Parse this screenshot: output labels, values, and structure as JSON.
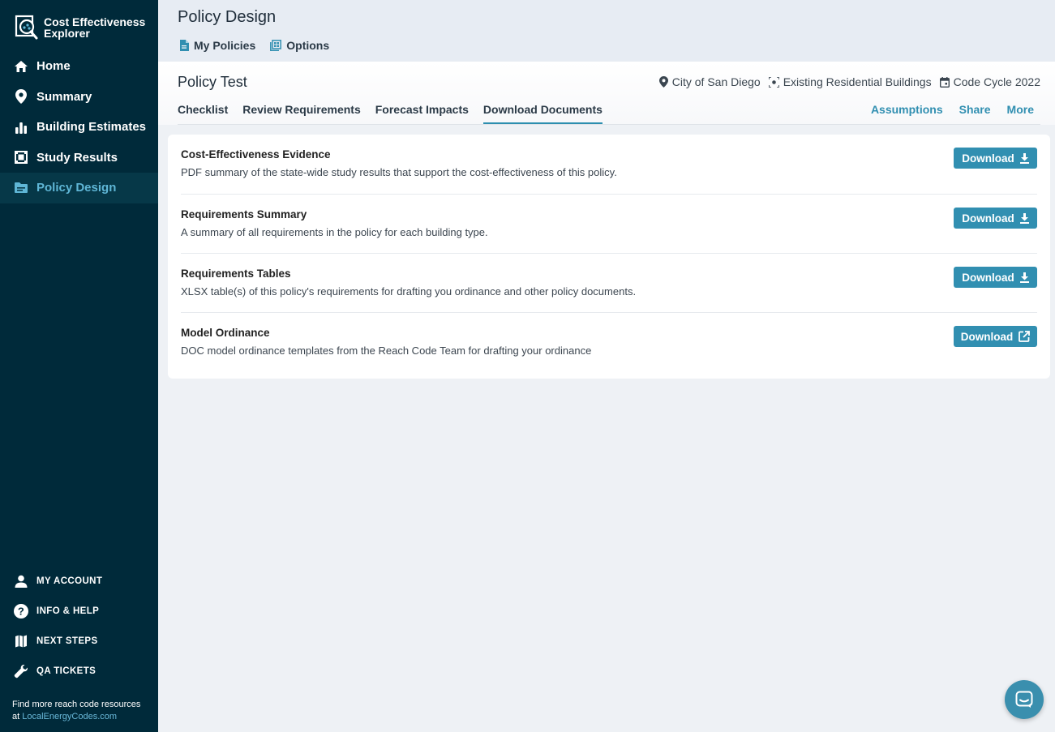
{
  "app": {
    "logo_text_line1": "Cost Effectiveness",
    "logo_text_line2": "Explorer"
  },
  "sidebar": {
    "items": [
      {
        "label": "Home",
        "icon": "home-icon"
      },
      {
        "label": "Summary",
        "icon": "map-pin-icon"
      },
      {
        "label": "Building Estimates",
        "icon": "bar-chart-icon"
      },
      {
        "label": "Study Results",
        "icon": "study-results-icon"
      },
      {
        "label": "Policy Design",
        "icon": "folder-icon",
        "active": true
      }
    ],
    "bottom_items": [
      {
        "label": "MY ACCOUNT",
        "icon": "user-icon"
      },
      {
        "label": "INFO & HELP",
        "icon": "help-icon"
      },
      {
        "label": "NEXT STEPS",
        "icon": "map-icon"
      },
      {
        "label": "QA TICKETS",
        "icon": "wrench-icon"
      }
    ],
    "footer_text": "Find more reach code resources at",
    "footer_link": "LocalEnergyCodes.com"
  },
  "header": {
    "title": "Policy Design",
    "links": [
      {
        "label": "My Policies",
        "icon": "document-icon"
      },
      {
        "label": "Options",
        "icon": "options-icon"
      }
    ]
  },
  "policy": {
    "name": "Policy Test",
    "meta": [
      {
        "label": "City of San Diego",
        "icon": "location-icon"
      },
      {
        "label": "Existing Residential Buildings",
        "icon": "building-scope-icon"
      },
      {
        "label": "Code Cycle 2022",
        "icon": "calendar-icon"
      }
    ],
    "tabs": [
      {
        "label": "Checklist"
      },
      {
        "label": "Review Requirements"
      },
      {
        "label": "Forecast Impacts"
      },
      {
        "label": "Download Documents",
        "active": true
      }
    ],
    "actions": [
      "Assumptions",
      "Share",
      "More"
    ]
  },
  "documents": [
    {
      "title": "Cost-Effectiveness Evidence",
      "description": "PDF summary of the state-wide study results that support the cost-effectiveness of this policy.",
      "button": "Download",
      "button_icon": "download-icon"
    },
    {
      "title": "Requirements Summary",
      "description": "A summary of all requirements in the policy for each building type.",
      "button": "Download",
      "button_icon": "download-icon"
    },
    {
      "title": "Requirements Tables",
      "description": "XLSX table(s) of this policy's requirements for drafting you ordinance and other policy documents.",
      "button": "Download",
      "button_icon": "download-icon"
    },
    {
      "title": "Model Ordinance",
      "description": "DOC model ordinance templates from the Reach Code Team for drafting your ordinance",
      "button": "Download",
      "button_icon": "external-link-icon"
    }
  ],
  "colors": {
    "sidebar_bg": "#002a3a",
    "accent": "#318fb1",
    "active_nav": "#5fb6d6"
  }
}
